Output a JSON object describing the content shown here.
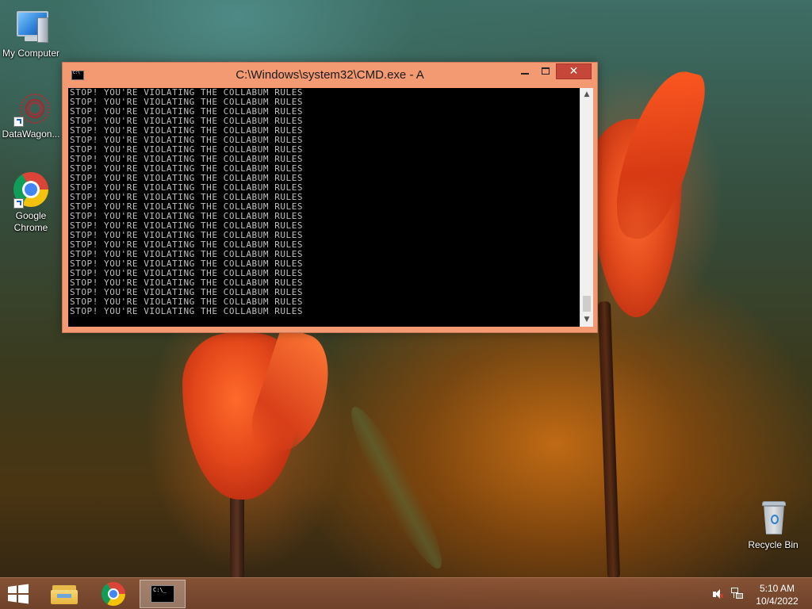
{
  "desktop": {
    "icons": [
      {
        "label": "My Computer",
        "icon": "computer-icon"
      },
      {
        "label": "DataWagon...",
        "icon": "datawagon-icon"
      },
      {
        "label": "Google Chrome",
        "icon": "chrome-icon"
      },
      {
        "label": "Recycle Bin",
        "icon": "recycle-bin-icon"
      }
    ]
  },
  "cmd_window": {
    "title": "C:\\Windows\\system32\\CMD.exe - A",
    "close_glyph": "✕",
    "line_text": "STOP! YOU'RE VIOLATING THE COLLABUM RULES",
    "line_count": 24,
    "accent_color": "#f39a73",
    "close_color": "#c7463a"
  },
  "taskbar": {
    "items": [
      {
        "name": "start",
        "icon": "windows-logo-icon"
      },
      {
        "name": "file-explorer",
        "icon": "folder-icon"
      },
      {
        "name": "chrome",
        "icon": "chrome-icon"
      },
      {
        "name": "command-prompt",
        "icon": "cmd-icon",
        "active": true
      }
    ],
    "tray": {
      "volume_icon": "speaker-muted-icon",
      "network_icon": "network-icon",
      "time": "5:10 AM",
      "date": "10/4/2022"
    }
  }
}
